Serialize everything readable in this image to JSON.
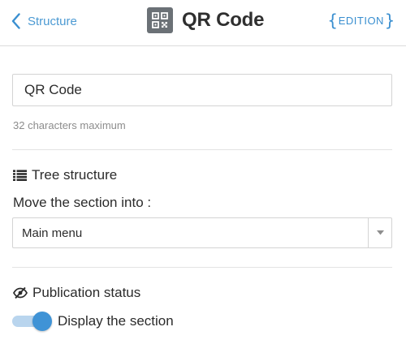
{
  "header": {
    "back_label": "Structure",
    "title": "QR Code",
    "edition_label": "EDITION",
    "edition_brace_open": "{",
    "edition_brace_close": "}"
  },
  "name_field": {
    "value": "QR Code",
    "hint": "32 characters maximum"
  },
  "tree_structure": {
    "heading": "Tree structure",
    "move_label": "Move the section into :",
    "selected_option": "Main menu"
  },
  "publication": {
    "heading": "Publication status",
    "toggle_label": "Display the section",
    "toggle_on": true
  },
  "colors": {
    "accent": "#3a8fd0",
    "icon_box": "#6b7176",
    "text": "#2b2b2b",
    "muted": "#8c8c8c",
    "toggle_track": "#b9d5ee",
    "toggle_knob": "#3f93d6"
  },
  "icons": {
    "back": "chevron-left-icon",
    "title": "qr-code-icon",
    "tree": "list-icon",
    "publication": "eye-slash-icon",
    "select": "caret-down-icon"
  }
}
